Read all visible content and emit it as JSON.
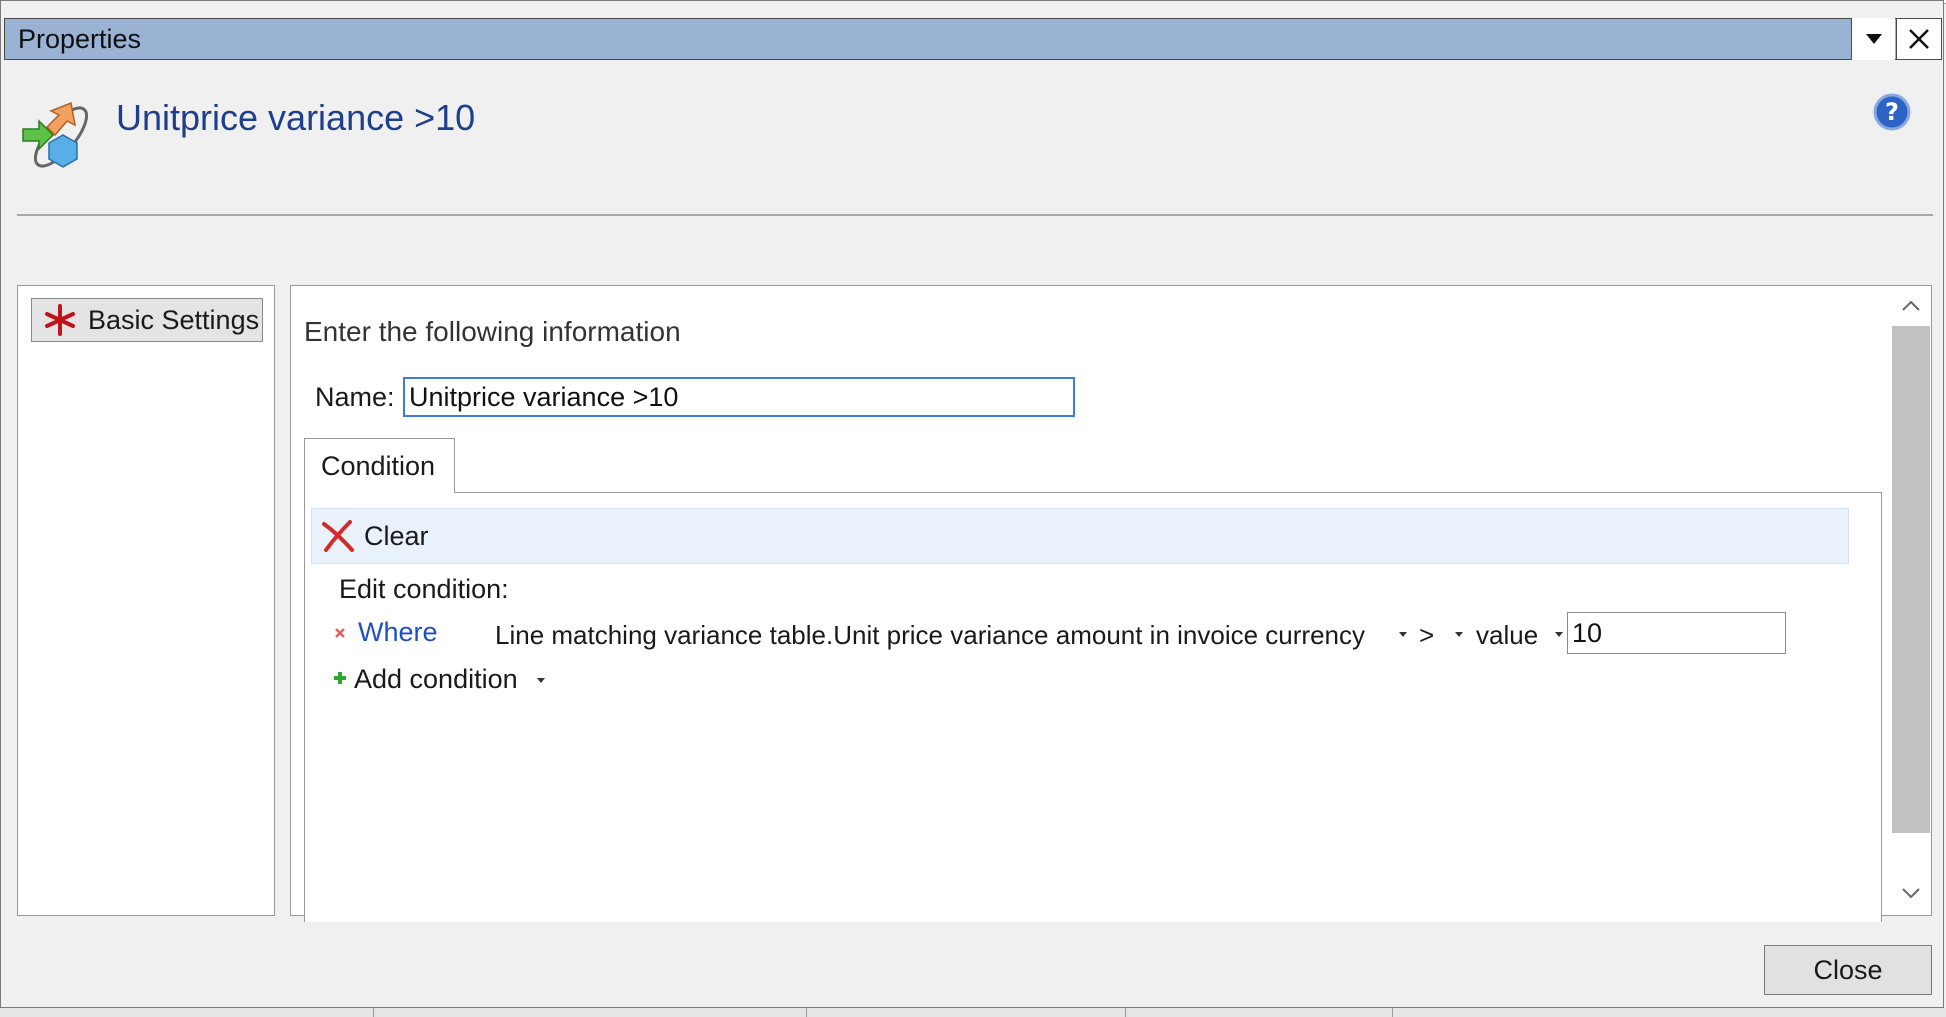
{
  "window": {
    "title": "Properties",
    "icons": {
      "menu": "chevron-down-icon",
      "close": "close-icon"
    }
  },
  "header": {
    "title": "Unitprice variance >10",
    "icon": "rule-arrows-icon",
    "help_icon": "help-icon"
  },
  "left_nav": {
    "items": [
      {
        "label": "Basic Settings",
        "icon": "required-star-icon"
      }
    ]
  },
  "form": {
    "instruction": "Enter the following information",
    "name_label": "Name:",
    "name_value": "Unitprice variance >10",
    "tabs": [
      {
        "label": "Condition",
        "active": true
      }
    ],
    "toolbar": {
      "clear_label": "Clear"
    },
    "edit_condition_label": "Edit condition:",
    "condition": {
      "connector": "Where",
      "field": "Line matching variance table.Unit price variance amount in invoice currency",
      "operator": ">",
      "value_type": "value",
      "value": "10"
    },
    "add_condition_label": "Add condition"
  },
  "footer": {
    "close_label": "Close"
  },
  "colors": {
    "titlebar": "#9ab3d4",
    "title_text": "#1e3f8c",
    "link": "#1f4fc4",
    "focus_border": "#3c7fd1",
    "clear_bar": "#e9f1fb"
  }
}
